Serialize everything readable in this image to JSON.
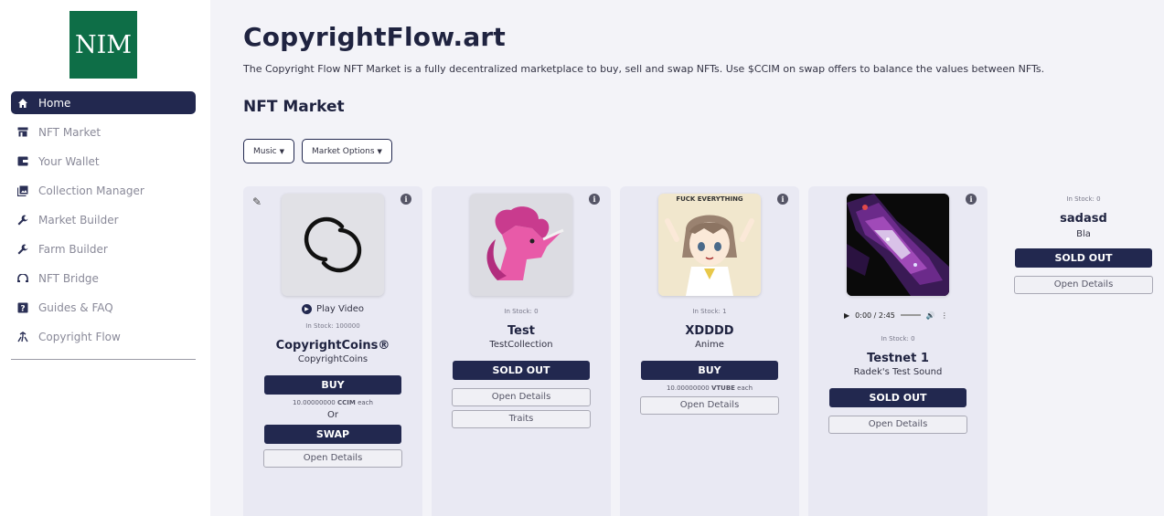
{
  "sidebar": {
    "logo_text": "NIM",
    "items": [
      {
        "label": "Home",
        "icon": "home-icon",
        "active": true
      },
      {
        "label": "NFT Market",
        "icon": "store-icon"
      },
      {
        "label": "Your Wallet",
        "icon": "wallet-icon"
      },
      {
        "label": "Collection Manager",
        "icon": "collection-icon"
      },
      {
        "label": "Market Builder",
        "icon": "wrench-icon"
      },
      {
        "label": "Farm Builder",
        "icon": "wrench-icon"
      },
      {
        "label": "NFT Bridge",
        "icon": "bridge-icon"
      },
      {
        "label": "Guides & FAQ",
        "icon": "question-icon"
      },
      {
        "label": "Copyright Flow",
        "icon": "flow-icon"
      }
    ]
  },
  "header": {
    "title": "CopyrightFlow.art",
    "subtitle": "The Copyright Flow NFT Market is a fully decentralized marketplace to buy, sell and swap NFTs. Use $CCIM on swap offers to balance the values between NFTs."
  },
  "section_title": "NFT Market",
  "filters": {
    "category": "Music",
    "options": "Market Options"
  },
  "cards": [
    {
      "play_label": "Play Video",
      "stock": "In Stock: 100000",
      "name": "CopyrightCoins®",
      "collection": "CopyrightCoins",
      "buy": "BUY",
      "price_num": "10.00000000",
      "price_cur": "CCIM",
      "price_suffix": "each",
      "or": "Or",
      "swap": "SWAP",
      "details": "Open Details"
    },
    {
      "stock": "In Stock: 0",
      "name": "Test",
      "collection": "TestCollection",
      "sold": "SOLD OUT",
      "details": "Open Details",
      "traits": "Traits"
    },
    {
      "image_caption": "FUCK EVERYTHING",
      "stock": "In Stock: 1",
      "name": "XDDDD",
      "collection": "Anime",
      "buy": "BUY",
      "price_num": "10.00000000",
      "price_cur": "VTUBE",
      "price_suffix": "each",
      "details": "Open Details"
    },
    {
      "audio_time": "0:00 / 2:45",
      "stock": "In Stock: 0",
      "name": "Testnet 1",
      "collection": "Radek's Test Sound",
      "sold": "SOLD OUT",
      "details": "Open Details"
    },
    {
      "stock": "In Stock: 0",
      "name": "sadasd",
      "collection": "Bla",
      "sold": "SOLD OUT",
      "details": "Open Details"
    }
  ],
  "colors": {
    "accent": "#22284f",
    "logo_bg": "#0e6e47",
    "page_bg": "#f3f3f8",
    "card_bg": "#e9e9f3"
  }
}
